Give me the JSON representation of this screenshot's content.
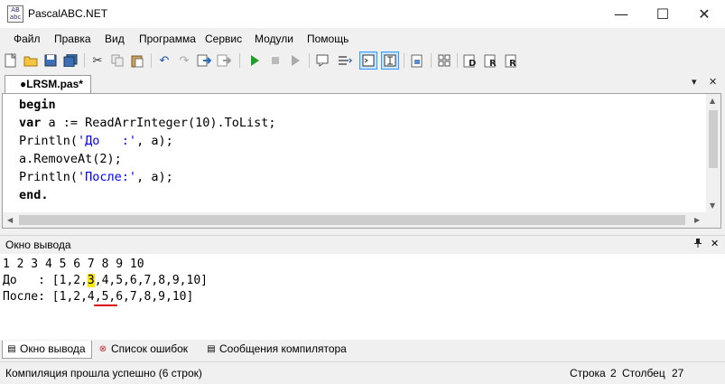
{
  "window": {
    "title": "PascalABC.NET",
    "app_icon_text": "AB abc"
  },
  "window_controls": {
    "minimize": "—",
    "maximize": "☐",
    "close": "✕"
  },
  "menu": [
    "Файл",
    "Правка",
    "Вид",
    "Программа",
    "Сервис",
    "Модули",
    "Помощь"
  ],
  "toolbar": {
    "icons": [
      "new-file-icon",
      "open-icon",
      "save-icon",
      "save-all-icon",
      "cut-icon",
      "copy-icon",
      "paste-icon",
      "undo-icon",
      "redo-icon",
      "find-icon",
      "replace-icon",
      "run-icon",
      "stop-icon",
      "debug-icon",
      "step-icon",
      "output-window-icon",
      "console-icon",
      "format-icon",
      "collapse-icon",
      "module-d-icon",
      "module-r-icon",
      "module-rr-icon"
    ]
  },
  "editor": {
    "tab_label": "●LRSM.pas*",
    "tab_menu": "▾",
    "tab_close": "✕",
    "code": [
      {
        "parts": [
          {
            "t": "begin",
            "c": "kw"
          }
        ]
      },
      {
        "parts": [
          {
            "t": "var",
            "c": "kw"
          },
          {
            "t": " a := ReadArrInteger(",
            "c": ""
          },
          {
            "t": "10",
            "c": "num"
          },
          {
            "t": ").ToList;",
            "c": ""
          }
        ]
      },
      {
        "parts": [
          {
            "t": "Println(",
            "c": ""
          },
          {
            "t": "'До   :'",
            "c": "str"
          },
          {
            "t": ", a);",
            "c": ""
          }
        ]
      },
      {
        "parts": [
          {
            "t": "a.RemoveAt(",
            "c": ""
          },
          {
            "t": "2",
            "c": "num"
          },
          {
            "t": ");",
            "c": ""
          }
        ]
      },
      {
        "parts": [
          {
            "t": "Println(",
            "c": ""
          },
          {
            "t": "'После:'",
            "c": "str"
          },
          {
            "t": ", a);",
            "c": ""
          }
        ]
      },
      {
        "parts": [
          {
            "t": "end.",
            "c": "kw"
          }
        ]
      }
    ]
  },
  "output": {
    "title": "Окно вывода",
    "pin": "📌",
    "close": "✕",
    "lines": [
      {
        "parts": [
          {
            "t": "1 2 3 4 5 6 7 8 9 10",
            "hl": false
          }
        ]
      },
      {
        "parts": [
          {
            "t": "До   : [1,2,",
            "hl": false
          },
          {
            "t": "3",
            "hl": true
          },
          {
            "t": ",4,5,6,7,8,9,10]",
            "hl": false
          }
        ]
      },
      {
        "parts": [
          {
            "t": "После: [1,2,4,5,6,7,8,9,10]",
            "hl": false
          }
        ]
      }
    ]
  },
  "bottom_tabs": [
    {
      "label": "Окно вывода",
      "icon": "▤",
      "name": "tab-output"
    },
    {
      "label": "Список ошибок",
      "icon": "⊗",
      "name": "tab-errors"
    },
    {
      "label": "Сообщения компилятора",
      "icon": "▤",
      "name": "tab-compiler-messages"
    }
  ],
  "status": {
    "message": "Компиляция прошла успешно (6 строк)",
    "row_label": "Строка",
    "row_value": "2",
    "col_label": "Столбец",
    "col_value": "27"
  }
}
